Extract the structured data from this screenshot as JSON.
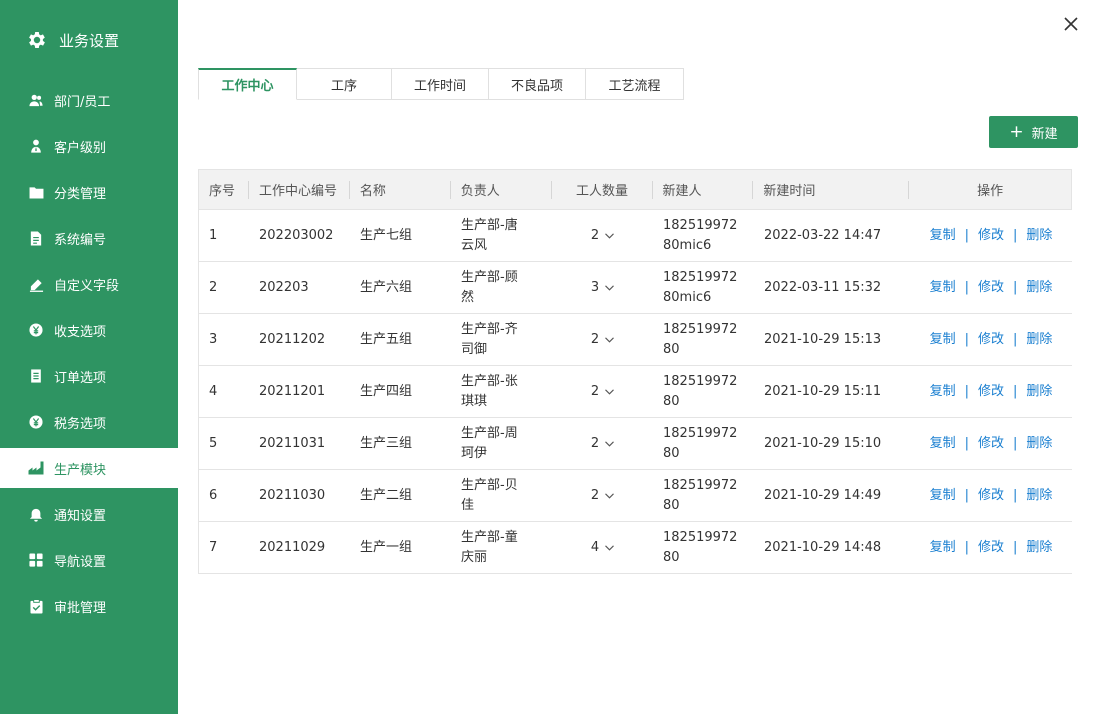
{
  "sidebar": {
    "title": "业务设置",
    "items": [
      {
        "label": "部门/员工",
        "icon": "users-icon"
      },
      {
        "label": "客户级别",
        "icon": "customer-icon"
      },
      {
        "label": "分类管理",
        "icon": "folder-icon"
      },
      {
        "label": "系统编号",
        "icon": "document-icon"
      },
      {
        "label": "自定义字段",
        "icon": "edit-icon"
      },
      {
        "label": "收支选项",
        "icon": "yen-circle-icon"
      },
      {
        "label": "订单选项",
        "icon": "list-icon"
      },
      {
        "label": "税务选项",
        "icon": "tax-icon"
      },
      {
        "label": "生产模块",
        "icon": "factory-icon"
      },
      {
        "label": "通知设置",
        "icon": "bell-icon"
      },
      {
        "label": "导航设置",
        "icon": "grid-icon"
      },
      {
        "label": "审批管理",
        "icon": "clipboard-check-icon"
      }
    ],
    "active_index": 8
  },
  "tabs": [
    "工作中心",
    "工序",
    "工作时间",
    "不良品项",
    "工艺流程"
  ],
  "active_tab": 0,
  "new_button": {
    "label": "新建"
  },
  "table": {
    "headers": [
      "序号",
      "工作中心编号",
      "名称",
      "负责人",
      "工人数量",
      "新建人",
      "新建时间",
      "操作"
    ],
    "rows": [
      {
        "no": "1",
        "code": "202203002",
        "name": "生产七组",
        "manager": "生产部-唐云风",
        "count": "2",
        "creator": "18251997280mic6",
        "time": "2022-03-22 14:47"
      },
      {
        "no": "2",
        "code": "202203",
        "name": "生产六组",
        "manager": "生产部-顾然",
        "count": "3",
        "creator": "18251997280mic6",
        "time": "2022-03-11 15:32"
      },
      {
        "no": "3",
        "code": "20211202",
        "name": "生产五组",
        "manager": "生产部-齐司御",
        "count": "2",
        "creator": "18251997280",
        "time": "2021-10-29 15:13"
      },
      {
        "no": "4",
        "code": "20211201",
        "name": "生产四组",
        "manager": "生产部-张琪琪",
        "count": "2",
        "creator": "18251997280",
        "time": "2021-10-29 15:11"
      },
      {
        "no": "5",
        "code": "20211031",
        "name": "生产三组",
        "manager": "生产部-周珂伊",
        "count": "2",
        "creator": "18251997280",
        "time": "2021-10-29 15:10"
      },
      {
        "no": "6",
        "code": "20211030",
        "name": "生产二组",
        "manager": "生产部-贝佳",
        "count": "2",
        "creator": "18251997280",
        "time": "2021-10-29 14:49"
      },
      {
        "no": "7",
        "code": "20211029",
        "name": "生产一组",
        "manager": "生产部-童庆丽",
        "count": "4",
        "creator": "18251997280",
        "time": "2021-10-29 14:48"
      }
    ],
    "actions": {
      "copy": "复制",
      "edit": "修改",
      "delete": "删除",
      "separator": "|"
    }
  },
  "colors": {
    "brand": "#2e9462",
    "link": "#1a7fd0"
  }
}
